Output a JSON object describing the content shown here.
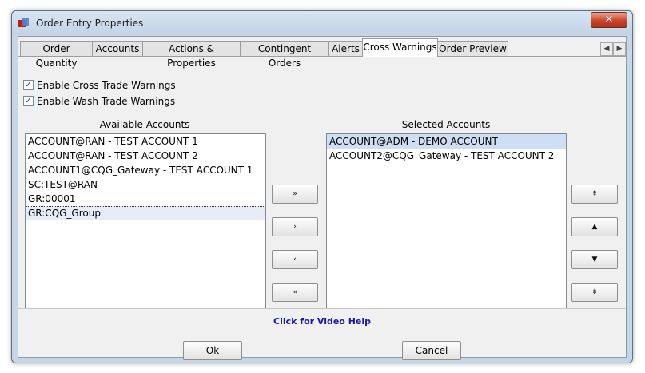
{
  "window": {
    "title": "Order Entry Properties",
    "close_symbol": "✕"
  },
  "tabs": [
    {
      "label": "Order Quantity"
    },
    {
      "label": "Accounts"
    },
    {
      "label": "Actions & Properties"
    },
    {
      "label": "Contingent Orders"
    },
    {
      "label": "Alerts"
    },
    {
      "label": "Cross Warnings"
    },
    {
      "label": "Order Preview"
    }
  ],
  "active_tab": "Cross Warnings",
  "tab_scroll": {
    "left": "◀",
    "right": "▶"
  },
  "options": {
    "cross_trade": {
      "label": "Enable Cross Trade Warnings",
      "checked": true
    },
    "wash_trade": {
      "label": "Enable Wash Trade Warnings",
      "checked": true
    }
  },
  "available": {
    "header": "Available Accounts",
    "items": [
      "ACCOUNT@RAN - TEST ACCOUNT 1",
      "ACCOUNT@RAN - TEST ACCOUNT 2",
      "ACCOUNT1@CQG_Gateway - TEST ACCOUNT 1",
      "SC:TEST@RAN",
      "GR:00001",
      "GR:CQG_Group"
    ],
    "focused_index": 5
  },
  "selected": {
    "header": "Selected Accounts",
    "items": [
      "ACCOUNT@ADM - DEMO ACCOUNT",
      "ACCOUNT2@CQG_Gateway - TEST ACCOUNT 2"
    ],
    "selected_index": 0
  },
  "transfer_buttons": {
    "add_all": "»",
    "add": "›",
    "remove": "‹",
    "remove_all": "«"
  },
  "order_buttons": {
    "move_top": "⇞",
    "move_up": "▲",
    "move_down": "▼",
    "move_bottom": "⇟"
  },
  "video_help": "Click for Video Help",
  "footer": {
    "ok": "Ok",
    "cancel": "Cancel"
  },
  "colors": {
    "link": "#1a1aa8",
    "selection": "#cfdff3",
    "title_bar": "#c7d6e6"
  }
}
